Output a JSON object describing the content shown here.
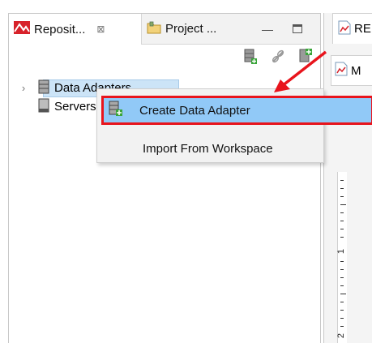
{
  "repository_view": {
    "active_tab_label": "Reposit...",
    "active_tab_close": "⊠",
    "inactive_tab_label": "Project ...",
    "minimize_glyph": "—",
    "tree": [
      {
        "label": "Data Adapters",
        "icon": "data-adapters-icon",
        "selected": true
      },
      {
        "label": "Servers",
        "icon": "servers-icon",
        "selected": false
      }
    ]
  },
  "editor": {
    "tab_label": "RE",
    "sub_tab_label": "M",
    "ruler_labels": [
      "1",
      "2"
    ]
  },
  "context_menu": {
    "items": [
      {
        "label": "Create Data Adapter",
        "icon": "create-data-adapter-icon",
        "highlighted": true
      },
      {
        "label": "Import From Workspace"
      }
    ]
  },
  "colors": {
    "highlight_fill": "#91c9f7",
    "highlight_border": "#e8141c",
    "selection": "#cce4f7",
    "arrow": "#e8141c"
  }
}
